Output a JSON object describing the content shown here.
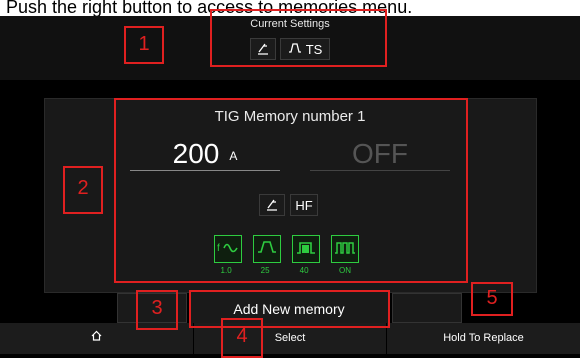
{
  "caption": "Push the right button to access to memories menu.",
  "current_settings": {
    "title": "Current Settings",
    "chip1_icon": "torch-icon",
    "chip2_label": "TS",
    "chip2_icon": "pulse-step-icon"
  },
  "memory": {
    "title": "TIG Memory number 1",
    "current_value": "200",
    "current_unit": "A",
    "second_value": "OFF",
    "mode_icon": "torch-icon",
    "mode_label": "HF",
    "functions": [
      {
        "icon": "frequency-icon",
        "value": "1.0"
      },
      {
        "icon": "pulse-step-icon",
        "value": "25"
      },
      {
        "icon": "pulse-bar-icon",
        "value": "40"
      },
      {
        "icon": "pulse-wave-icon",
        "value": "ON"
      }
    ]
  },
  "add_memory_label": "Add New memory",
  "nav": {
    "home_icon": "home-icon",
    "select_label": "Select",
    "replace_label": "Hold To Replace"
  },
  "annotations": [
    "1",
    "2",
    "3",
    "4",
    "5"
  ],
  "colors": {
    "accent_green": "#2ecc40",
    "annotation_red": "#e02020"
  }
}
